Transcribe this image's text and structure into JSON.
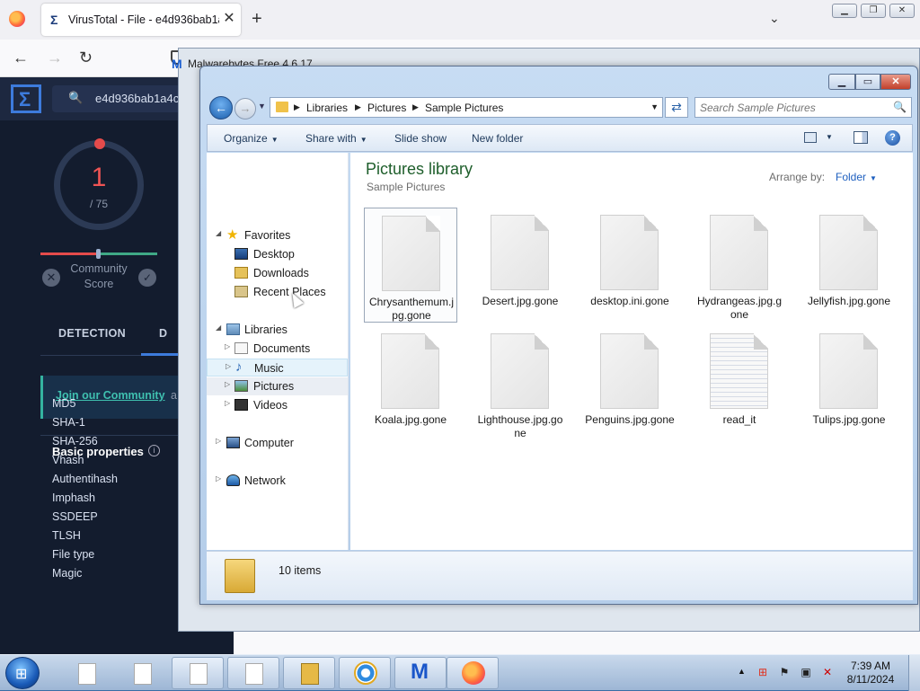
{
  "browser": {
    "tab_title": "VirusTotal - File - e4d936bab1a4",
    "tab_favicon": "virustotal-icon",
    "new_tab_label": "+",
    "list_tabs_label": "⌄"
  },
  "virustotal": {
    "search_value": "e4d936bab1a4c",
    "score": "1",
    "score_total": "/ 75",
    "community_label": "Community Score",
    "tabs": [
      "DETECTION",
      "D"
    ],
    "banner_link": "Join our Community",
    "banner_rest": "a",
    "basic_properties_title": "Basic properties",
    "properties": [
      "MD5",
      "SHA-1",
      "SHA-256",
      "Vhash",
      "Authentihash",
      "Imphash",
      "SSDEEP",
      "TLSH",
      "File type",
      "Magic"
    ],
    "colors": {
      "score_red": "#ef5454",
      "accent_teal": "#3fc0b0",
      "bg": "#131c2e"
    }
  },
  "malwarebytes": {
    "title": "Malwarebytes Free 4.6.17"
  },
  "explorer": {
    "breadcrumbs": [
      "Libraries",
      "Pictures",
      "Sample Pictures"
    ],
    "search_placeholder": "Search Sample Pictures",
    "toolbar": {
      "organize": "Organize",
      "share_with": "Share with",
      "slide_show": "Slide show",
      "new_folder": "New folder"
    },
    "nav": {
      "favorites": "Favorites",
      "desktop": "Desktop",
      "downloads": "Downloads",
      "recent_places": "Recent Places",
      "libraries": "Libraries",
      "documents": "Documents",
      "music": "Music",
      "pictures": "Pictures",
      "videos": "Videos",
      "computer": "Computer",
      "network": "Network"
    },
    "library_title": "Pictures library",
    "library_subtitle": "Sample Pictures",
    "arrange_by_label": "Arrange by:",
    "arrange_by_value": "Folder",
    "files": [
      "Chrysanthemum.jpg.gone",
      "Desert.jpg.gone",
      "desktop.ini.gone",
      "Hydrangeas.jpg.gone",
      "Jellyfish.jpg.gone",
      "Koala.jpg.gone",
      "Lighthouse.jpg.gone",
      "Penguins.jpg.gone",
      "read_it",
      "Tulips.jpg.gone"
    ],
    "item_count": "10 items"
  },
  "taskbar": {
    "time": "7:39 AM",
    "date": "8/11/2024",
    "apps": [
      "document-icon",
      "document-icon",
      "document-icon",
      "document-icon",
      "explorer-icon",
      "internet-explorer-icon",
      "malwarebytes-icon",
      "firefox-icon"
    ]
  }
}
